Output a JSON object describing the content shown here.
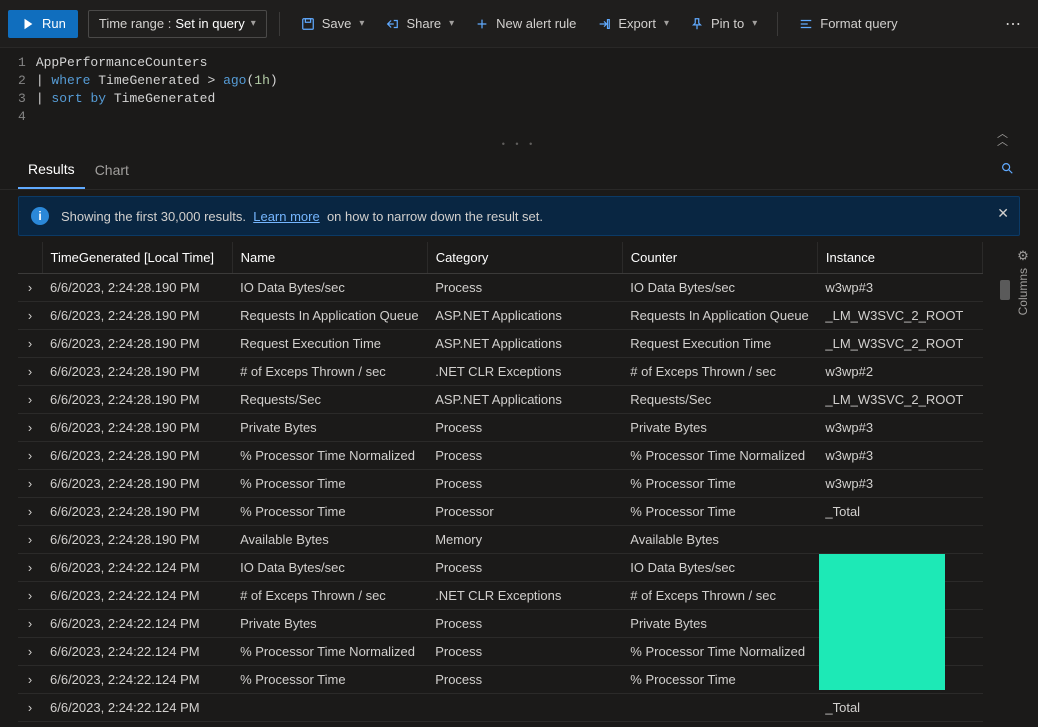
{
  "toolbar": {
    "run": "Run",
    "time_range_label": "Time range :",
    "time_range_value": "Set in query",
    "save": "Save",
    "share": "Share",
    "new_alert": "New alert rule",
    "export": "Export",
    "pin_to": "Pin to",
    "format_query": "Format query"
  },
  "editor": {
    "lines": [
      "1",
      "2",
      "3",
      "4"
    ],
    "code_plain": "AppPerformanceCounters\n| where TimeGenerated > ago(1h)\n| sort by TimeGenerated\n"
  },
  "tabs": {
    "results": "Results",
    "chart": "Chart"
  },
  "info": {
    "text1": "Showing the first 30,000 results.",
    "learn_more": "Learn more",
    "text2": "on how to narrow down the result set."
  },
  "columns_label": "Columns",
  "table": {
    "headers": {
      "time": "TimeGenerated [Local Time]",
      "name": "Name",
      "category": "Category",
      "counter": "Counter",
      "instance": "Instance"
    },
    "rows": [
      {
        "time": "6/6/2023, 2:24:28.190 PM",
        "name": "IO Data Bytes/sec",
        "category": "Process",
        "counter": "IO Data Bytes/sec",
        "instance": "w3wp#3"
      },
      {
        "time": "6/6/2023, 2:24:28.190 PM",
        "name": "Requests In Application Queue",
        "category": "ASP.NET Applications",
        "counter": "Requests In Application Queue",
        "instance": "_LM_W3SVC_2_ROOT"
      },
      {
        "time": "6/6/2023, 2:24:28.190 PM",
        "name": "Request Execution Time",
        "category": "ASP.NET Applications",
        "counter": "Request Execution Time",
        "instance": "_LM_W3SVC_2_ROOT"
      },
      {
        "time": "6/6/2023, 2:24:28.190 PM",
        "name": "# of Exceps Thrown / sec",
        "category": ".NET CLR Exceptions",
        "counter": "# of Exceps Thrown / sec",
        "instance": "w3wp#2"
      },
      {
        "time": "6/6/2023, 2:24:28.190 PM",
        "name": "Requests/Sec",
        "category": "ASP.NET Applications",
        "counter": "Requests/Sec",
        "instance": "_LM_W3SVC_2_ROOT"
      },
      {
        "time": "6/6/2023, 2:24:28.190 PM",
        "name": "Private Bytes",
        "category": "Process",
        "counter": "Private Bytes",
        "instance": "w3wp#3"
      },
      {
        "time": "6/6/2023, 2:24:28.190 PM",
        "name": "% Processor Time Normalized",
        "category": "Process",
        "counter": "% Processor Time Normalized",
        "instance": "w3wp#3"
      },
      {
        "time": "6/6/2023, 2:24:28.190 PM",
        "name": "% Processor Time",
        "category": "Process",
        "counter": "% Processor Time",
        "instance": "w3wp#3"
      },
      {
        "time": "6/6/2023, 2:24:28.190 PM",
        "name": "% Processor Time",
        "category": "Processor",
        "counter": "% Processor Time",
        "instance": "_Total"
      },
      {
        "time": "6/6/2023, 2:24:28.190 PM",
        "name": "Available Bytes",
        "category": "Memory",
        "counter": "Available Bytes",
        "instance": ""
      },
      {
        "time": "6/6/2023, 2:24:22.124 PM",
        "name": "IO Data Bytes/sec",
        "category": "Process",
        "counter": "IO Data Bytes/sec",
        "instance": ""
      },
      {
        "time": "6/6/2023, 2:24:22.124 PM",
        "name": "# of Exceps Thrown / sec",
        "category": ".NET CLR Exceptions",
        "counter": "# of Exceps Thrown / sec",
        "instance": ""
      },
      {
        "time": "6/6/2023, 2:24:22.124 PM",
        "name": "Private Bytes",
        "category": "Process",
        "counter": "Private Bytes",
        "instance": ""
      },
      {
        "time": "6/6/2023, 2:24:22.124 PM",
        "name": "% Processor Time Normalized",
        "category": "Process",
        "counter": "% Processor Time Normalized",
        "instance": ""
      },
      {
        "time": "6/6/2023, 2:24:22.124 PM",
        "name": "% Processor Time",
        "category": "Process",
        "counter": "% Processor Time",
        "instance": ""
      },
      {
        "time": "6/6/2023, 2:24:22.124 PM",
        "name": "",
        "category": "",
        "counter": "",
        "instance": "_Total"
      }
    ]
  }
}
